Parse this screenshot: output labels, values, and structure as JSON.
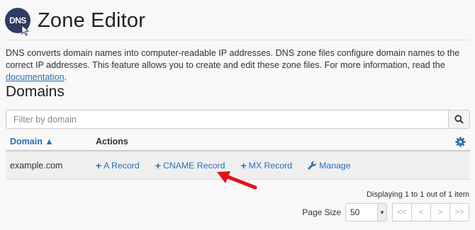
{
  "header": {
    "logo_text": "DNS",
    "title": "Zone Editor"
  },
  "description": {
    "text": "DNS converts domain names into computer-readable IP addresses. DNS zone files configure domain names to the correct IP addresses. This feature allows you to create and edit these zone files. For more information, read the ",
    "link_text": "documentation",
    "suffix": "."
  },
  "section": {
    "title": "Domains"
  },
  "filter": {
    "placeholder": "Filter by domain",
    "search_icon": "search-icon"
  },
  "table": {
    "columns": {
      "domain": "Domain ▲",
      "actions": "Actions"
    },
    "settings_icon": "gear-icon",
    "rows": [
      {
        "domain": "example.com",
        "actions": {
          "a_record": "A Record",
          "cname_record": "CNAME Record",
          "mx_record": "MX Record",
          "manage": "Manage"
        }
      }
    ]
  },
  "annotation": {
    "arrow_color": "#e3101b",
    "target": "CNAME Record"
  },
  "pagination": {
    "info": "Displaying 1 to 1 out of 1 item",
    "page_size_label": "Page Size",
    "page_size": "50",
    "first": "<<",
    "prev": "<",
    "next": ">",
    "last": ">>"
  },
  "colors": {
    "link": "#2a6fb3",
    "logo_bg": "#2f3b62",
    "background": "#f8f8f8"
  }
}
